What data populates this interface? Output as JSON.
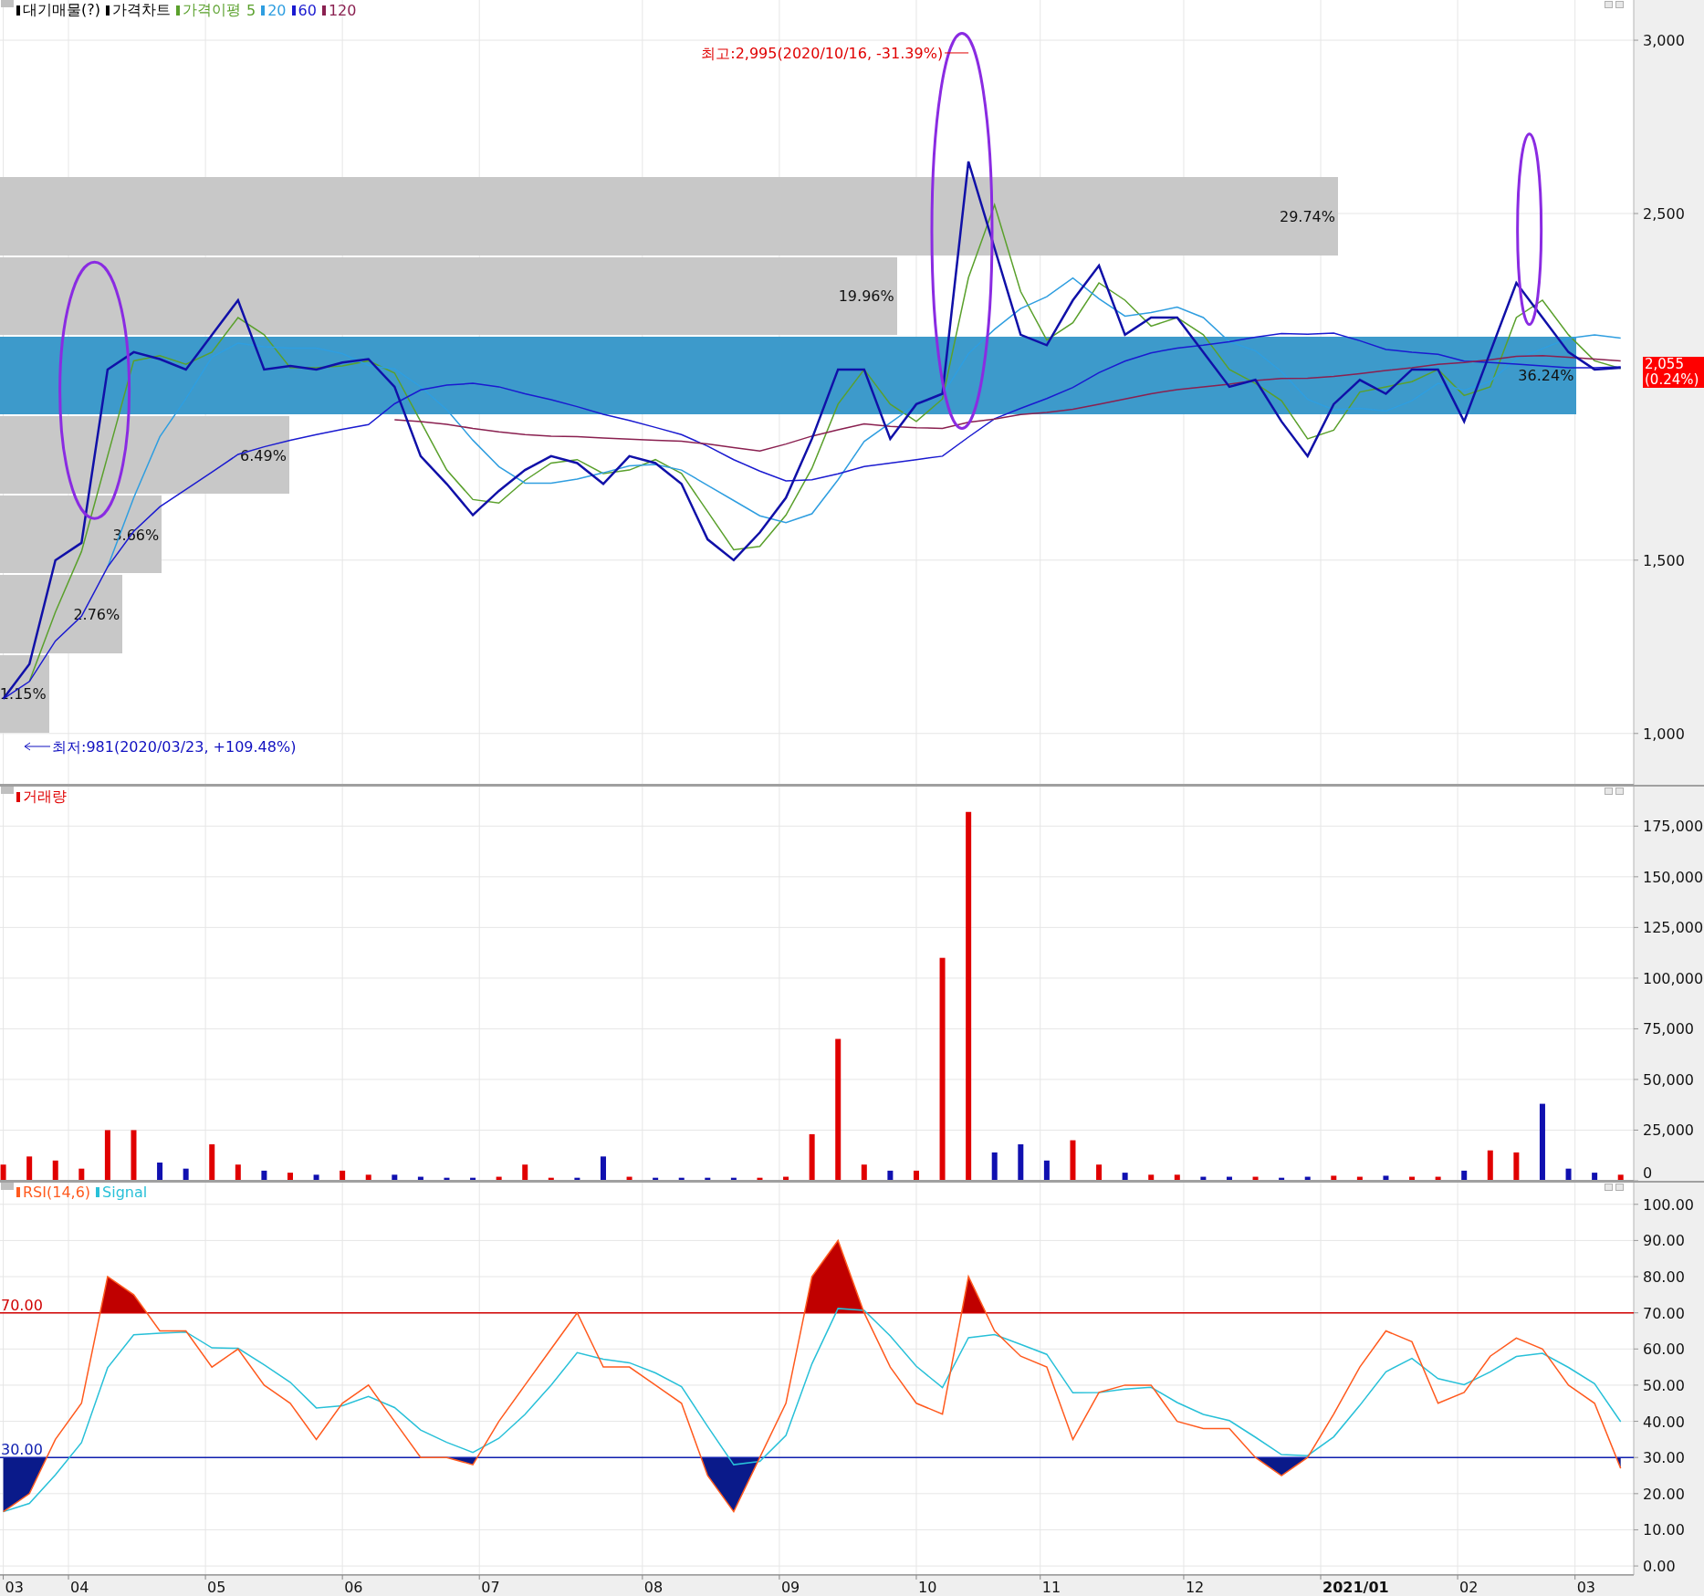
{
  "price_pane": {
    "legend": [
      {
        "text": "대기매물(?)",
        "color": "#000000",
        "marker": true
      },
      {
        "text": "가격차트",
        "color": "#000000",
        "marker": true
      },
      {
        "text": "가격이평",
        "color": "#5aa02c",
        "marker": true
      },
      {
        "text": "5",
        "color": "#5aa02c",
        "marker": false
      },
      {
        "text": "20",
        "color": "#2f9ee0",
        "marker": true
      },
      {
        "text": "60",
        "color": "#1a1ad0",
        "marker": true
      },
      {
        "text": "120",
        "color": "#8a2050",
        "marker": true
      }
    ],
    "volume_profile": [
      {
        "label": "1.15%",
        "level": 0.03,
        "selected": false
      },
      {
        "label": "2.76%",
        "level": 0.075,
        "selected": false
      },
      {
        "label": "3.66%",
        "level": 0.099,
        "selected": false
      },
      {
        "label": "6.49%",
        "level": 0.177,
        "selected": false
      },
      {
        "label": "36.24%",
        "level": 0.965,
        "selected": true
      },
      {
        "label": "19.96%",
        "level": 0.549,
        "selected": false
      },
      {
        "label": "29.74%",
        "level": 0.819,
        "selected": false
      }
    ],
    "price_tag": {
      "price": "2,055",
      "change": "(0.24%)"
    },
    "chart_data": {
      "type": "line",
      "grid": true,
      "ylim": [
        852,
        3116
      ],
      "yticks": [
        {
          "value": 1000,
          "label": "1,000"
        },
        {
          "value": 1500,
          "label": "1,500"
        },
        {
          "value": 2500,
          "label": "2,500"
        },
        {
          "value": 3000,
          "label": "3,000"
        }
      ],
      "categories": [
        null,
        null,
        null,
        null,
        null,
        null,
        null,
        null,
        null,
        null,
        null,
        null,
        null,
        null,
        null,
        null,
        null,
        null,
        null,
        null,
        null,
        null,
        null,
        null,
        null,
        null,
        null,
        null,
        null,
        null,
        null,
        null,
        null,
        null,
        null,
        null,
        null,
        null,
        null,
        null,
        null,
        null,
        null,
        null,
        null,
        null,
        null,
        null,
        null,
        null,
        null,
        null,
        null,
        null,
        null,
        null,
        null,
        null,
        null,
        null,
        null,
        null,
        null
      ],
      "series": [
        {
          "color": "#1010a8",
          "values": [
            1100,
            1200,
            1500,
            1550,
            2050,
            2100,
            2080,
            2050,
            2150,
            2250,
            2050,
            2060,
            2050,
            2070,
            2080,
            2000,
            1800,
            1720,
            1630,
            1700,
            1760,
            1800,
            1780,
            1720,
            1800,
            1780,
            1720,
            1560,
            1500,
            1580,
            1680,
            1850,
            2050,
            2050,
            1850,
            1950,
            1980,
            2650,
            2400,
            2150,
            2120,
            2250,
            2350,
            2150,
            2200,
            2200,
            2100,
            2000,
            2020,
            1900,
            1800,
            1950,
            2020,
            1980,
            2050,
            2050,
            1900,
            2100,
            2300,
            2200,
            2100,
            2050,
            2055
          ]
        },
        {
          "color": "#5aa02c",
          "values": [
            null,
            1150,
            1350,
            1525,
            1800,
            2075,
            2090,
            2065,
            2100,
            2200,
            2150,
            2055,
            2055,
            2060,
            2075,
            2040,
            1900,
            1760,
            1675,
            1665,
            1730,
            1780,
            1790,
            1750,
            1760,
            1790,
            1750,
            1640,
            1530,
            1540,
            1630,
            1765,
            1950,
            2050,
            1950,
            1900,
            1965,
            2315,
            2525,
            2275,
            2135,
            2185,
            2300,
            2250,
            2175,
            2200,
            2150,
            2050,
            2010,
            1960,
            1850,
            1875,
            1985,
            2000,
            2015,
            2050,
            1975,
            2000,
            2200,
            2250,
            2150,
            2075,
            2053
          ]
        },
        {
          "color": "#2f9ee0",
          "values": [
            null,
            null,
            null,
            null,
            1480,
            1680,
            1856,
            1966,
            2086,
            2126,
            2116,
            2112,
            2112,
            2096,
            2062,
            2052,
            2000,
            1934,
            1846,
            1770,
            1722,
            1722,
            1734,
            1752,
            1772,
            1776,
            1760,
            1716,
            1672,
            1628,
            1608,
            1634,
            1732,
            1842,
            1896,
            1950,
            1976,
            2096,
            2166,
            2226,
            2260,
            2314,
            2254,
            2204,
            2214,
            2230,
            2200,
            2130,
            2104,
            2044,
            1964,
            1934,
            1938,
            1930,
            1960,
            2010,
            1990,
            2016,
            2080,
            2110,
            2140,
            2150,
            2141
          ]
        },
        {
          "color": "#1a1ad0",
          "values": [
            1100,
            1150,
            1267,
            1338,
            1480,
            1583,
            1654,
            1704,
            1754,
            1805,
            1827,
            1846,
            1862,
            1877,
            1891,
            1951,
            1991,
            2005,
            2010,
            2000,
            1980,
            1963,
            1943,
            1921,
            1903,
            1883,
            1862,
            1829,
            1790,
            1757,
            1729,
            1732,
            1749,
            1770,
            1780,
            1790,
            1800,
            1855,
            1908,
            1938,
            1966,
            1998,
            2041,
            2074,
            2098,
            2112,
            2120,
            2130,
            2143,
            2154,
            2152,
            2155,
            2133,
            2108,
            2100,
            2094,
            2074,
            2070,
            2066,
            2060,
            2055,
            2055,
            2058
          ]
        },
        {
          "color": "#8a2050",
          "values": [
            null,
            null,
            null,
            null,
            null,
            null,
            null,
            null,
            null,
            null,
            null,
            null,
            null,
            null,
            null,
            1905,
            1900,
            1892,
            1880,
            1870,
            1862,
            1858,
            1856,
            1852,
            1849,
            1846,
            1843,
            1835,
            1825,
            1815,
            1835,
            1858,
            1876,
            1893,
            1886,
            1882,
            1880,
            1898,
            1907,
            1920,
            1926,
            1935,
            1950,
            1965,
            1980,
            1992,
            2000,
            2008,
            2018,
            2024,
            2025,
            2030,
            2038,
            2047,
            2055,
            2065,
            2070,
            2078,
            2088,
            2090,
            2085,
            2080,
            2075
          ]
        }
      ],
      "annotations": [
        {
          "text": "최고:2,995(2020/10/16, -31.39%)"
        },
        {
          "text": "최저:981(2020/03/23, +109.48%)"
        }
      ]
    }
  },
  "volume_pane": {
    "legend": [
      {
        "text": "거래량",
        "color": "#e00000"
      }
    ],
    "chart_data": {
      "type": "bar",
      "grid": true,
      "ylim": [
        0,
        194500
      ],
      "yticks": [
        {
          "value": 0,
          "label": "0"
        },
        {
          "value": 25000,
          "label": "25,000"
        },
        {
          "value": 50000,
          "label": "50,000"
        },
        {
          "value": 75000,
          "label": "75,000"
        },
        {
          "value": 100000,
          "label": "100,000"
        },
        {
          "value": 125000,
          "label": "125,000"
        },
        {
          "value": 150000,
          "label": "150,000"
        },
        {
          "value": 175000,
          "label": "175,000"
        }
      ],
      "categories": [
        null,
        null,
        null,
        null,
        null,
        null,
        null,
        null,
        null,
        null,
        null,
        null,
        null,
        null,
        null,
        null,
        null,
        null,
        null,
        null,
        null,
        null,
        null,
        null,
        null,
        null,
        null,
        null,
        null,
        null,
        null,
        null,
        null,
        null,
        null,
        null,
        null,
        null,
        null,
        null,
        null,
        null,
        null,
        null,
        null,
        null,
        null,
        null,
        null,
        null,
        null,
        null,
        null,
        null,
        null,
        null,
        null,
        null,
        null,
        null,
        null,
        null,
        null
      ],
      "values": [
        8000,
        12000,
        10000,
        6000,
        25000,
        25000,
        9000,
        6000,
        18000,
        8000,
        5000,
        4000,
        3000,
        5000,
        3000,
        3000,
        2000,
        1500,
        1500,
        2000,
        8000,
        1500,
        1500,
        12000,
        2000,
        1500,
        1500,
        1500,
        1500,
        1500,
        2000,
        23000,
        70000,
        8000,
        5000,
        5000,
        110000,
        182000,
        14000,
        18000,
        10000,
        20000,
        8000,
        4000,
        3000,
        3000,
        2000,
        2000,
        2000,
        1500,
        2000,
        2500,
        2000,
        2500,
        2000,
        2000,
        5000,
        15000,
        14000,
        38000,
        6000,
        4000,
        3000
      ]
    }
  },
  "rsi_pane": {
    "legend": [
      {
        "text": "RSI(14,6)",
        "color": "#ff5a1e"
      },
      {
        "text": "Signal",
        "color": "#28c0d8"
      }
    ],
    "chart_data": {
      "type": "line",
      "grid": true,
      "ylim": [
        -2.5,
        106
      ],
      "yticks": [
        {
          "value": 0,
          "label": "0.00"
        },
        {
          "value": 10,
          "label": "10.00"
        },
        {
          "value": 20,
          "label": "20.00"
        },
        {
          "value": 30,
          "label": "30.00"
        },
        {
          "value": 40,
          "label": "40.00"
        },
        {
          "value": 50,
          "label": "50.00"
        },
        {
          "value": 60,
          "label": "60.00"
        },
        {
          "value": 70,
          "label": "70.00"
        },
        {
          "value": 80,
          "label": "80.00"
        },
        {
          "value": 90,
          "label": "90.00"
        },
        {
          "value": 100,
          "label": "100.00"
        }
      ],
      "categories": [
        null,
        null,
        null,
        null,
        null,
        null,
        null,
        null,
        null,
        null,
        null,
        null,
        null,
        null,
        null,
        null,
        null,
        null,
        null,
        null,
        null,
        null,
        null,
        null,
        null,
        null,
        null,
        null,
        null,
        null,
        null,
        null,
        null,
        null,
        null,
        null,
        null,
        null,
        null,
        null,
        null,
        null,
        null,
        null,
        null,
        null,
        null,
        null,
        null,
        null,
        null,
        null,
        null,
        null,
        null,
        null,
        null,
        null,
        null,
        null,
        null,
        null,
        null
      ],
      "series": [
        {
          "color": "#ff5a1e",
          "values": [
            15,
            20,
            35,
            45,
            80,
            75,
            65,
            65,
            55,
            60,
            50,
            45,
            35,
            45,
            50,
            40,
            30,
            30,
            28,
            40,
            50,
            60,
            70,
            55,
            55,
            50,
            45,
            25,
            15,
            30,
            45,
            80,
            90,
            70,
            55,
            45,
            42,
            80,
            65,
            58,
            55,
            35,
            48,
            50,
            50,
            40,
            38,
            38,
            30,
            25,
            30,
            42,
            55,
            65,
            62,
            45,
            48,
            58,
            63,
            60,
            50,
            45,
            27
          ]
        },
        {
          "color": "#28c0d8",
          "values": [
            15,
            17.3,
            25.2,
            34.1,
            54.8,
            63.9,
            64.4,
            64.7,
            60.3,
            60.2,
            55.6,
            50.8,
            43.7,
            44.3,
            46.9,
            43.8,
            37.6,
            34.2,
            31.4,
            35.3,
            41.9,
            50,
            59,
            57.2,
            56.2,
            53.4,
            49.6,
            38.6,
            28,
            28.9,
            36.1,
            55.9,
            71.2,
            70.7,
            63.6,
            55.2,
            49.3,
            63.1,
            64,
            61.3,
            58.5,
            47.9,
            48,
            48.9,
            49.4,
            45.2,
            41.9,
            40.2,
            35.6,
            30.8,
            30.5,
            35.7,
            44.4,
            53.7,
            57.4,
            51.8,
            50.1,
            53.7,
            57.9,
            58.8,
            54.9,
            50.4,
            39.9
          ]
        }
      ],
      "ref_lines": [
        {
          "axis": "y",
          "value": 70,
          "label": "70.00",
          "color": "#d00000"
        },
        {
          "axis": "y",
          "value": 30,
          "label": "30.00",
          "color": "#1020b0"
        }
      ]
    }
  },
  "x_axis": {
    "ticks": [
      {
        "label": "03",
        "bold": false
      },
      {
        "label": "04",
        "bold": false
      },
      {
        "label": "05",
        "bold": false
      },
      {
        "label": "06",
        "bold": false
      },
      {
        "label": "07",
        "bold": false
      },
      {
        "label": "08",
        "bold": false
      },
      {
        "label": "09",
        "bold": false
      },
      {
        "label": "10",
        "bold": false
      },
      {
        "label": "11",
        "bold": false
      },
      {
        "label": "12",
        "bold": false
      },
      {
        "label": "2021/01",
        "bold": true
      },
      {
        "label": "02",
        "bold": false
      },
      {
        "label": "03",
        "bold": false
      }
    ]
  }
}
